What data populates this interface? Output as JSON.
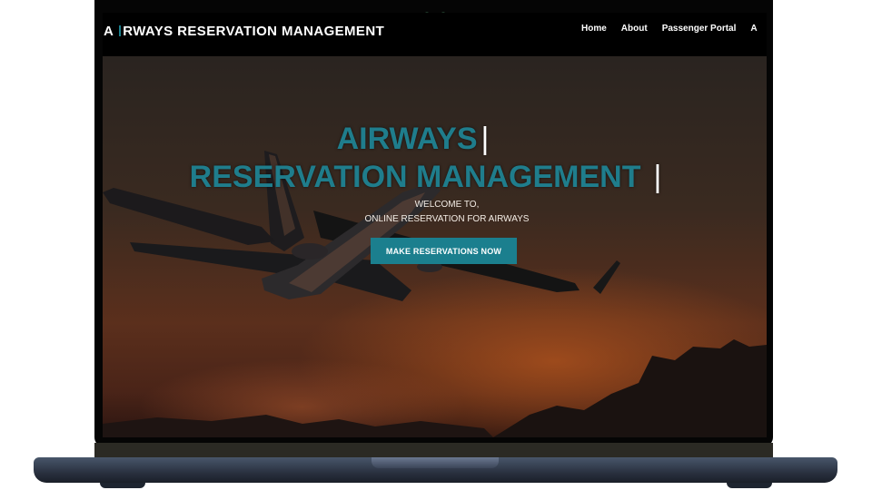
{
  "brand": {
    "prefix": "A",
    "suffix": "RWAYS RESERVATION MANAGEMENT"
  },
  "nav": {
    "items": [
      {
        "label": "Home"
      },
      {
        "label": "About"
      },
      {
        "label": "Passenger Portal"
      },
      {
        "label": "A"
      }
    ]
  },
  "hero": {
    "title_line1": "AIRWAYS",
    "title_line2": "RESERVATION MANAGEMENT",
    "caret": "|",
    "welcome_line1": "WELCOME TO,",
    "welcome_line2": "ONLINE RESERVATION FOR AIRWAYS",
    "cta_label": "MAKE RESERVATIONS NOW"
  },
  "colors": {
    "accent": "#1b7f8e",
    "navbar": "#000000",
    "sky_glow": "#aa501c"
  }
}
